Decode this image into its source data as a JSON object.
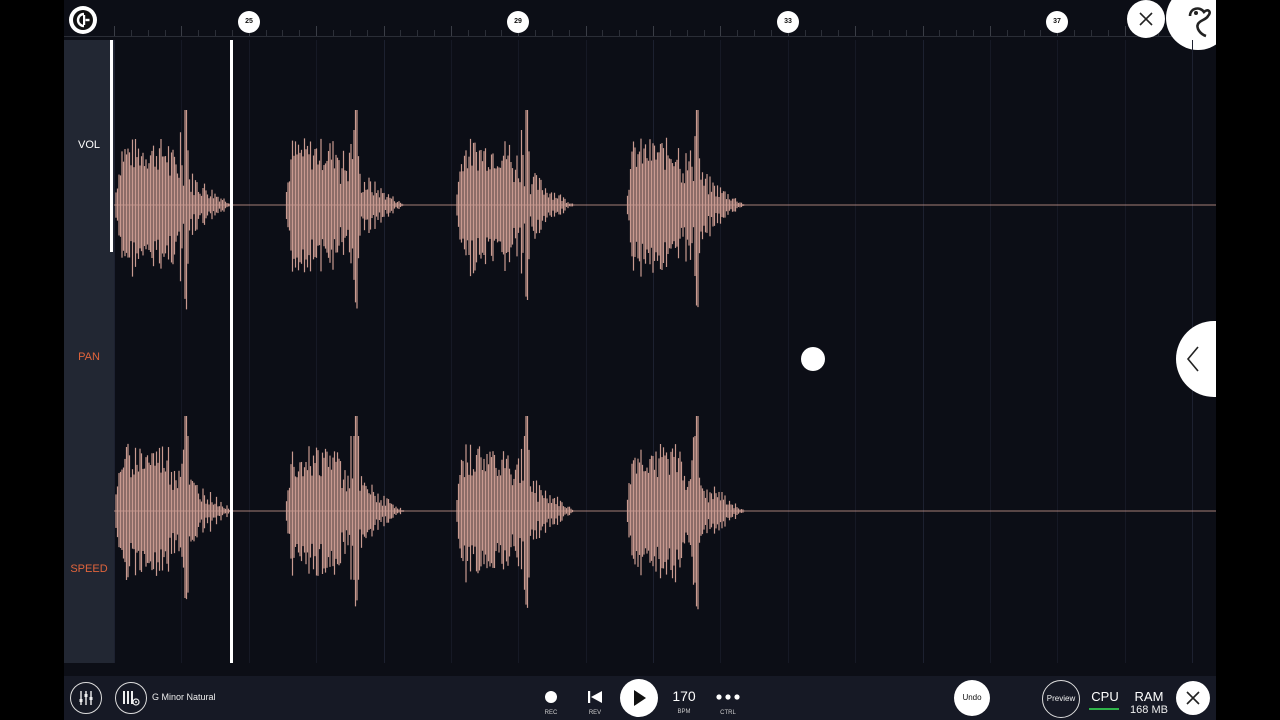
{
  "ruler": {
    "bar_markers": [
      "25",
      "29",
      "33",
      "37"
    ]
  },
  "params": {
    "vol_label": "VOL",
    "pan_label": "PAN",
    "speed_label": "SPEED"
  },
  "toolbar": {
    "scale_name": "G Minor Natural",
    "rec_label": "REC",
    "rev_label": "REV",
    "bpm_value": "170",
    "bpm_label": "BPM",
    "ctrl_label": "CTRL",
    "undo_label": "Undo",
    "preview_label": "Preview",
    "cpu_label": "CPU",
    "ram_label": "RAM",
    "ram_value": "168 MB"
  },
  "icons": {
    "logo": "app-logo-icon",
    "close": "close-icon",
    "mascot": "mascot-icon",
    "mixer": "mixer-icon",
    "piano_settings": "piano-settings-icon",
    "record": "record-icon",
    "rewind": "skip-back-icon",
    "play": "play-icon",
    "more": "more-icon",
    "expand": "chevron-left-icon"
  },
  "colors": {
    "background": "#0c0e16",
    "waveform": "#c99a90",
    "param_accent": "#e0643c",
    "cpu_meter": "#2fb34a"
  }
}
